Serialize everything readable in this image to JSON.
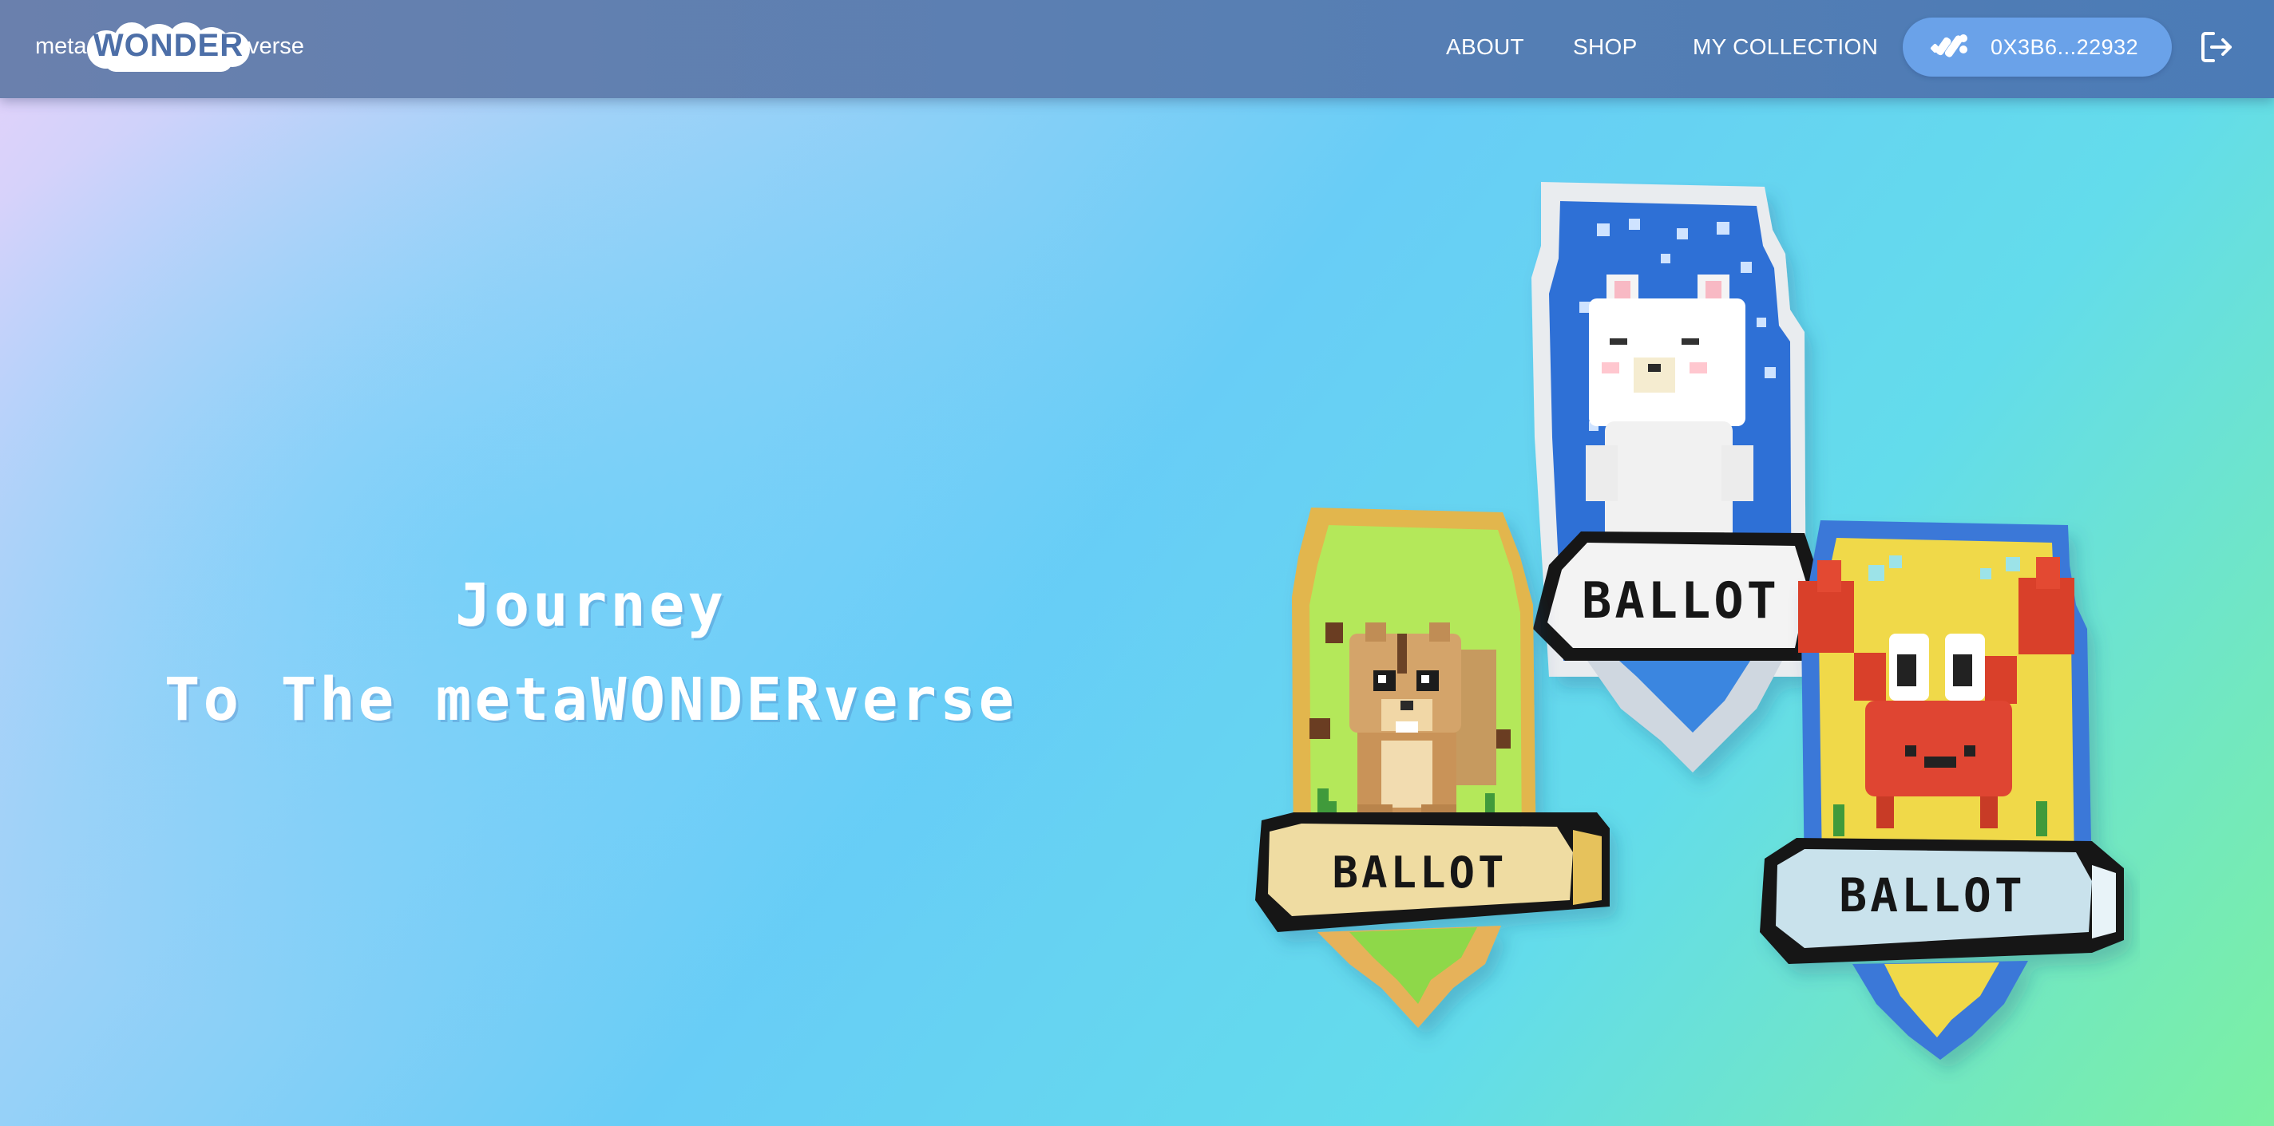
{
  "header": {
    "logo": {
      "prefix": "meta",
      "brand": "WONDER",
      "suffix": "verse"
    },
    "nav": [
      {
        "label": "ABOUT"
      },
      {
        "label": "SHOP"
      },
      {
        "label": "MY COLLECTION"
      }
    ],
    "wallet": {
      "icon": "wallet-brand-icon",
      "address": "0X3B6...22932"
    },
    "logout_icon": "logout-icon"
  },
  "hero": {
    "title_line1": "Journey",
    "title_line2": "To The metaWONDERverse"
  },
  "badges": [
    {
      "character": "white bear",
      "label": "BALLOT",
      "frame_color": "#2f6fd6"
    },
    {
      "character": "chipmunk",
      "label": "BALLOT",
      "frame_color": "#e0b850"
    },
    {
      "character": "crab",
      "label": "BALLOT",
      "frame_color": "#3b78d8"
    }
  ]
}
